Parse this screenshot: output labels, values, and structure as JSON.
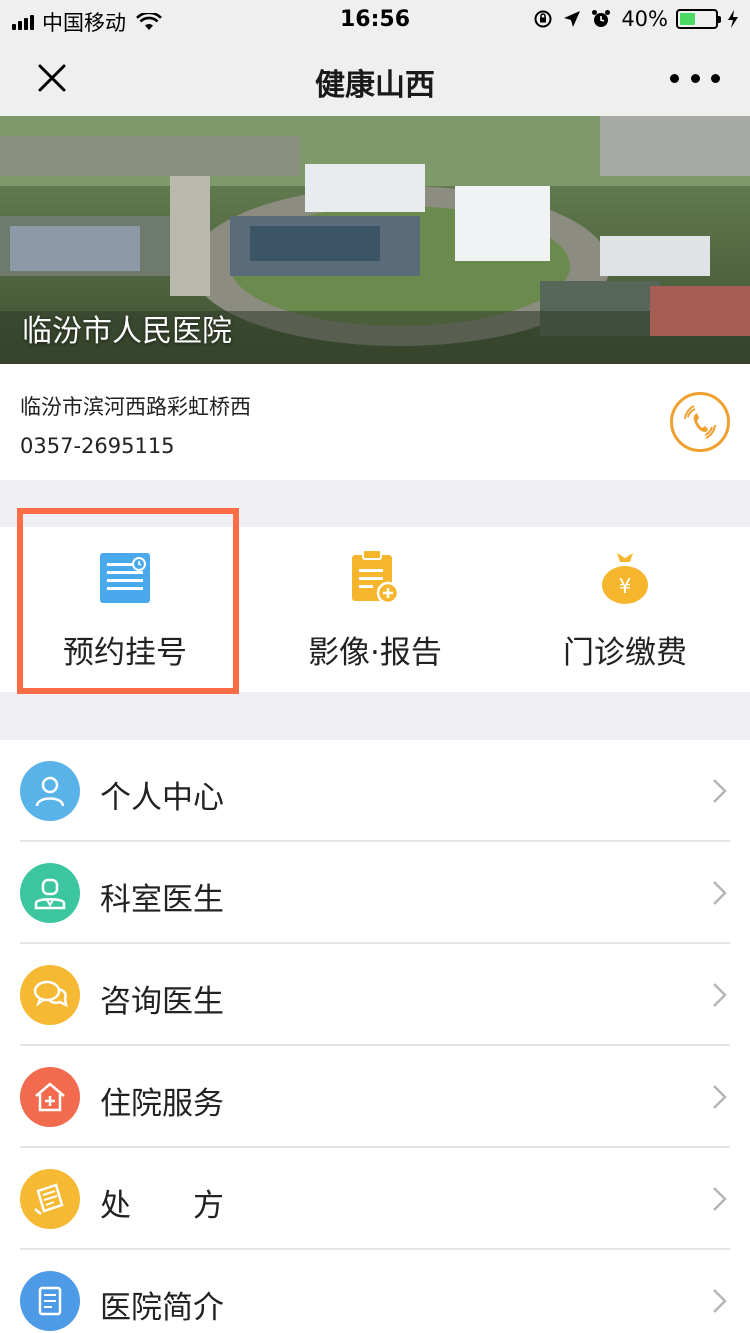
{
  "status_bar": {
    "carrier": "中国移动",
    "time": "16:56",
    "battery": "40%",
    "battery_level": 0.4
  },
  "nav": {
    "title": "健康山西"
  },
  "hospital": {
    "name": "临汾市人民医院",
    "address": "临汾市滨河西路彩虹桥西",
    "phone": "0357-2695115"
  },
  "actions": [
    {
      "label": "预约挂号",
      "icon": "calendar-list-icon",
      "color": "#4aa8ec"
    },
    {
      "label": "影像·报告",
      "icon": "report-clipboard-icon",
      "color": "#f5b62e"
    },
    {
      "label": "门诊缴费",
      "icon": "money-bag-icon",
      "color": "#f5b62e"
    }
  ],
  "menu": [
    {
      "label": "个人中心",
      "icon": "person-icon",
      "color": "#5ab3e8"
    },
    {
      "label": "科室医生",
      "icon": "doctor-icon",
      "color": "#3cc6a0"
    },
    {
      "label": "咨询医生",
      "icon": "chat-bubbles-icon",
      "color": "#f6b933"
    },
    {
      "label": "住院服务",
      "icon": "hospital-house-icon",
      "color": "#f26b4f"
    },
    {
      "label": "处　　方",
      "icon": "prescription-icon",
      "color": "#f6b933"
    },
    {
      "label": "医院简介",
      "icon": "document-icon",
      "color": "#4d9be6"
    }
  ],
  "colors": {
    "highlight": "#fb6e45",
    "phone_accent": "#f0a030"
  }
}
